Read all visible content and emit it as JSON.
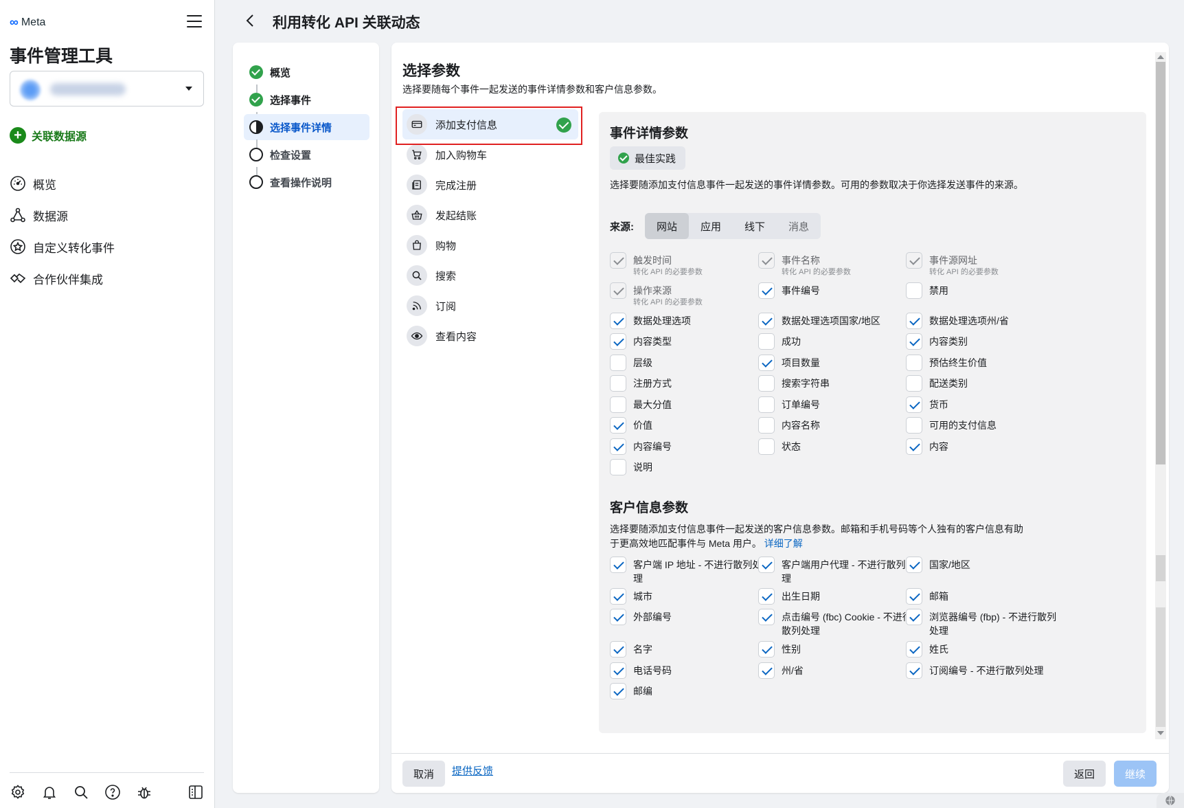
{
  "sidebar": {
    "brand": "Meta",
    "app_title": "事件管理工具",
    "connect_label": "关联数据源",
    "nav": [
      {
        "label": "概览",
        "icon": "dashboard-icon"
      },
      {
        "label": "数据源",
        "icon": "data-sources-icon"
      },
      {
        "label": "自定义转化事件",
        "icon": "star-badge-icon"
      },
      {
        "label": "合作伙伴集成",
        "icon": "handshake-icon"
      }
    ],
    "footer_icons": [
      "settings-icon",
      "bell-icon",
      "search-icon",
      "help-icon",
      "bug-icon",
      "panel-toggle-icon"
    ]
  },
  "header": {
    "title": "利用转化 API 关联动态"
  },
  "steps": [
    {
      "label": "概览",
      "state": "done"
    },
    {
      "label": "选择事件",
      "state": "done"
    },
    {
      "label": "选择事件详情",
      "state": "active"
    },
    {
      "label": "检查设置",
      "state": "pending"
    },
    {
      "label": "查看操作说明",
      "state": "pending"
    }
  ],
  "main": {
    "title": "选择参数",
    "description": "选择要随每个事件一起发送的事件详情参数和客户信息参数。",
    "events": [
      {
        "label": "添加支付信息",
        "icon": "credit-card-icon",
        "selected": true,
        "complete": true
      },
      {
        "label": "加入购物车",
        "icon": "cart-icon"
      },
      {
        "label": "完成注册",
        "icon": "registration-form-icon"
      },
      {
        "label": "发起结账",
        "icon": "basket-icon"
      },
      {
        "label": "购物",
        "icon": "shopping-bag-icon"
      },
      {
        "label": "搜索",
        "icon": "search-icon"
      },
      {
        "label": "订阅",
        "icon": "rss-icon"
      },
      {
        "label": "查看内容",
        "icon": "eye-icon"
      }
    ],
    "event_params": {
      "title": "事件详情参数",
      "best_practice": "最佳实践",
      "description": "选择要随添加支付信息事件一起发送的事件详情参数。可用的参数取决于你选择发送事件的来源。",
      "source_label": "来源:",
      "sources": [
        "网站",
        "应用",
        "线下",
        "消息"
      ],
      "required_note": "转化 API 的必要参数",
      "items": [
        {
          "label": "触发时间",
          "state": "locked",
          "sub": true
        },
        {
          "label": "事件名称",
          "state": "locked",
          "sub": true
        },
        {
          "label": "事件源网址",
          "state": "locked",
          "sub": true
        },
        {
          "label": "操作来源",
          "state": "locked",
          "sub": true
        },
        {
          "label": "事件编号",
          "state": "on"
        },
        {
          "label": "禁用",
          "state": "off"
        },
        {
          "label": "数据处理选项",
          "state": "on"
        },
        {
          "label": "数据处理选项国家/地区",
          "state": "on"
        },
        {
          "label": "数据处理选项州/省",
          "state": "on"
        },
        {
          "label": "内容类型",
          "state": "on"
        },
        {
          "label": "成功",
          "state": "off"
        },
        {
          "label": "内容类别",
          "state": "on"
        },
        {
          "label": "层级",
          "state": "off"
        },
        {
          "label": "项目数量",
          "state": "on"
        },
        {
          "label": "预估终生价值",
          "state": "off"
        },
        {
          "label": "注册方式",
          "state": "off"
        },
        {
          "label": "搜索字符串",
          "state": "off"
        },
        {
          "label": "配送类别",
          "state": "off"
        },
        {
          "label": "最大分值",
          "state": "off"
        },
        {
          "label": "订单编号",
          "state": "off"
        },
        {
          "label": "货币",
          "state": "on"
        },
        {
          "label": "价值",
          "state": "on"
        },
        {
          "label": "内容名称",
          "state": "off"
        },
        {
          "label": "可用的支付信息",
          "state": "off"
        },
        {
          "label": "内容编号",
          "state": "on"
        },
        {
          "label": "状态",
          "state": "off"
        },
        {
          "label": "内容",
          "state": "on"
        },
        {
          "label": "说明",
          "state": "off"
        }
      ]
    },
    "customer_params": {
      "title": "客户信息参数",
      "description": "选择要随添加支付信息事件一起发送的客户信息参数。邮箱和手机号码等个人独有的客户信息有助于更高效地匹配事件与 Meta 用户。",
      "learn_more": "详细了解",
      "items": [
        {
          "label": "客户端 IP 地址 - 不进行散列处理",
          "state": "on"
        },
        {
          "label": "客户端用户代理 - 不进行散列处理",
          "state": "on"
        },
        {
          "label": "国家/地区",
          "state": "on"
        },
        {
          "label": "城市",
          "state": "on"
        },
        {
          "label": "出生日期",
          "state": "on"
        },
        {
          "label": "邮箱",
          "state": "on"
        },
        {
          "label": "外部编号",
          "state": "on"
        },
        {
          "label": "点击编号 (fbc) Cookie - 不进行散列处理",
          "state": "on"
        },
        {
          "label": "浏览器编号 (fbp) - 不进行散列处理",
          "state": "on"
        },
        {
          "label": "名字",
          "state": "on"
        },
        {
          "label": "性别",
          "state": "on"
        },
        {
          "label": "姓氏",
          "state": "on"
        },
        {
          "label": "电话号码",
          "state": "on"
        },
        {
          "label": "州/省",
          "state": "on"
        },
        {
          "label": "订阅编号 - 不进行散列处理",
          "state": "on"
        },
        {
          "label": "邮编",
          "state": "on"
        }
      ]
    },
    "footer": {
      "cancel": "取消",
      "feedback": "提供反馈",
      "back": "返回",
      "continue": "继续"
    }
  },
  "colors": {
    "accent": "#0a66c2",
    "success": "#31a24c",
    "highlight": "#e02020"
  }
}
